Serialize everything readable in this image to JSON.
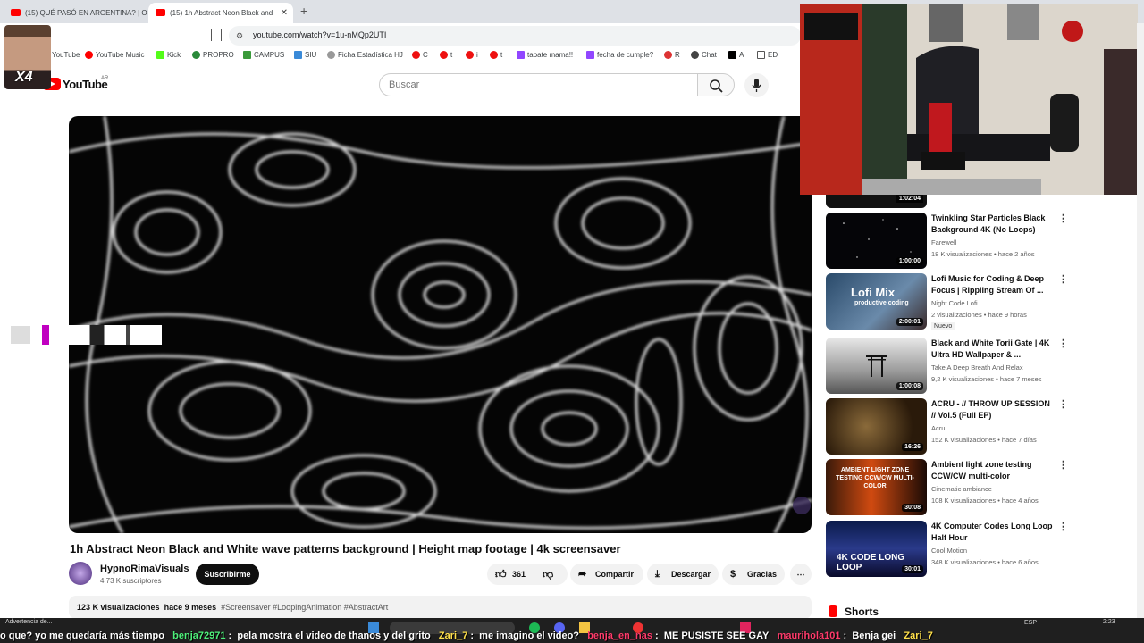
{
  "browser": {
    "tabs": [
      {
        "title": "(15) QUÉ PASÓ EN ARGENTINA? | O(",
        "active": false
      },
      {
        "title": "(15) 1h Abstract Neon Black and",
        "active": true
      }
    ],
    "url": "youtube.com/watch?v=1u-nMQp2UTI",
    "bookmarks": [
      "YouTube",
      "YouTube Music",
      "Kick",
      "PROPRO",
      "CAMPUS",
      "SIU",
      "Ficha Estadística HJ",
      "C",
      "t",
      "i",
      "t",
      "tapate mama!!",
      "fecha de cumple?",
      "R",
      "Chat",
      "A",
      "ED"
    ]
  },
  "youtube": {
    "logo_text": "YouTube",
    "country": "AR",
    "search_placeholder": "Buscar"
  },
  "video": {
    "title": "1h Abstract Neon Black and White wave patterns background | Height map footage | 4k screensaver",
    "channel": "HypnoRimaVisuals",
    "subscribers": "4,73 K suscriptores",
    "subscribe_label": "Suscribirme",
    "likes": "361",
    "share_label": "Compartir",
    "download_label": "Descargar",
    "thanks_label": "Gracias",
    "views": "123 K visualizaciones",
    "age": "hace 9 meses",
    "tags": "#Screensaver #LoopingAnimation #AbstractArt"
  },
  "recommendations": [
    {
      "title": "Twinkling Star Particles Black Background 4K (No Loops)",
      "channel": "Farewell",
      "meta": "18 K visualizaciones • hace 2 años",
      "duration": "1:00:00"
    },
    {
      "title": "Lofi Music for Coding & Deep Focus | Rippling Stream Of ...",
      "channel": "Night Code Lofi",
      "meta": "2 visualizaciones • hace 9 horas",
      "duration": "2:00:01",
      "badge": "Nuevo",
      "thumb_text": "Lofi Mix",
      "thumb_sub": "productive coding"
    },
    {
      "title": "Black and White Torii Gate | 4K Ultra HD Wallpaper & ...",
      "channel": "Take A Deep Breath And Relax",
      "meta": "9,2 K visualizaciones • hace 7 meses",
      "duration": "1:00:08"
    },
    {
      "title": "ACRU - // THROW UP SESSION // Vol.5 (Full EP)",
      "channel": "Acru",
      "meta": "152 K visualizaciones • hace 7 días",
      "duration": "16:26"
    },
    {
      "title": "Ambient light zone testing CCW/CW multi-color",
      "channel": "Cinematic ambiance",
      "meta": "108 K visualizaciones • hace 4 años",
      "duration": "30:08",
      "thumb_text": "AMBIENT LIGHT ZONE TESTING CCW/CW MULTI-COLOR"
    },
    {
      "title": "4K Computer Codes Long Loop Half Hour",
      "channel": "Cool Motion",
      "meta": "348 K visualizaciones • hace 6 años",
      "duration": "30:01",
      "thumb_text": "4K CODE LONG LOOP"
    }
  ],
  "top_partial_duration": "1:02:04",
  "shorts_label": "Shorts",
  "overlay": {
    "face_label": "X4",
    "ticker": [
      {
        "user": "",
        "msg": "o que?  yo me quedaría más tiempo"
      },
      {
        "user": "benja72971",
        "msg": "pela mostra el video de thanos  y del grito"
      },
      {
        "user": "Zari_7",
        "msg": "me imagino el video?"
      },
      {
        "user": "benja_en_nas",
        "msg": "ME PUSISTE SEE GAY"
      },
      {
        "user": "maurihola101",
        "msg": "Benja gei"
      },
      {
        "user": "Zari_7",
        "msg": ""
      }
    ]
  },
  "taskbar": {
    "warning": "Advertencia de...",
    "lang": "ESP",
    "time": "2:23"
  }
}
